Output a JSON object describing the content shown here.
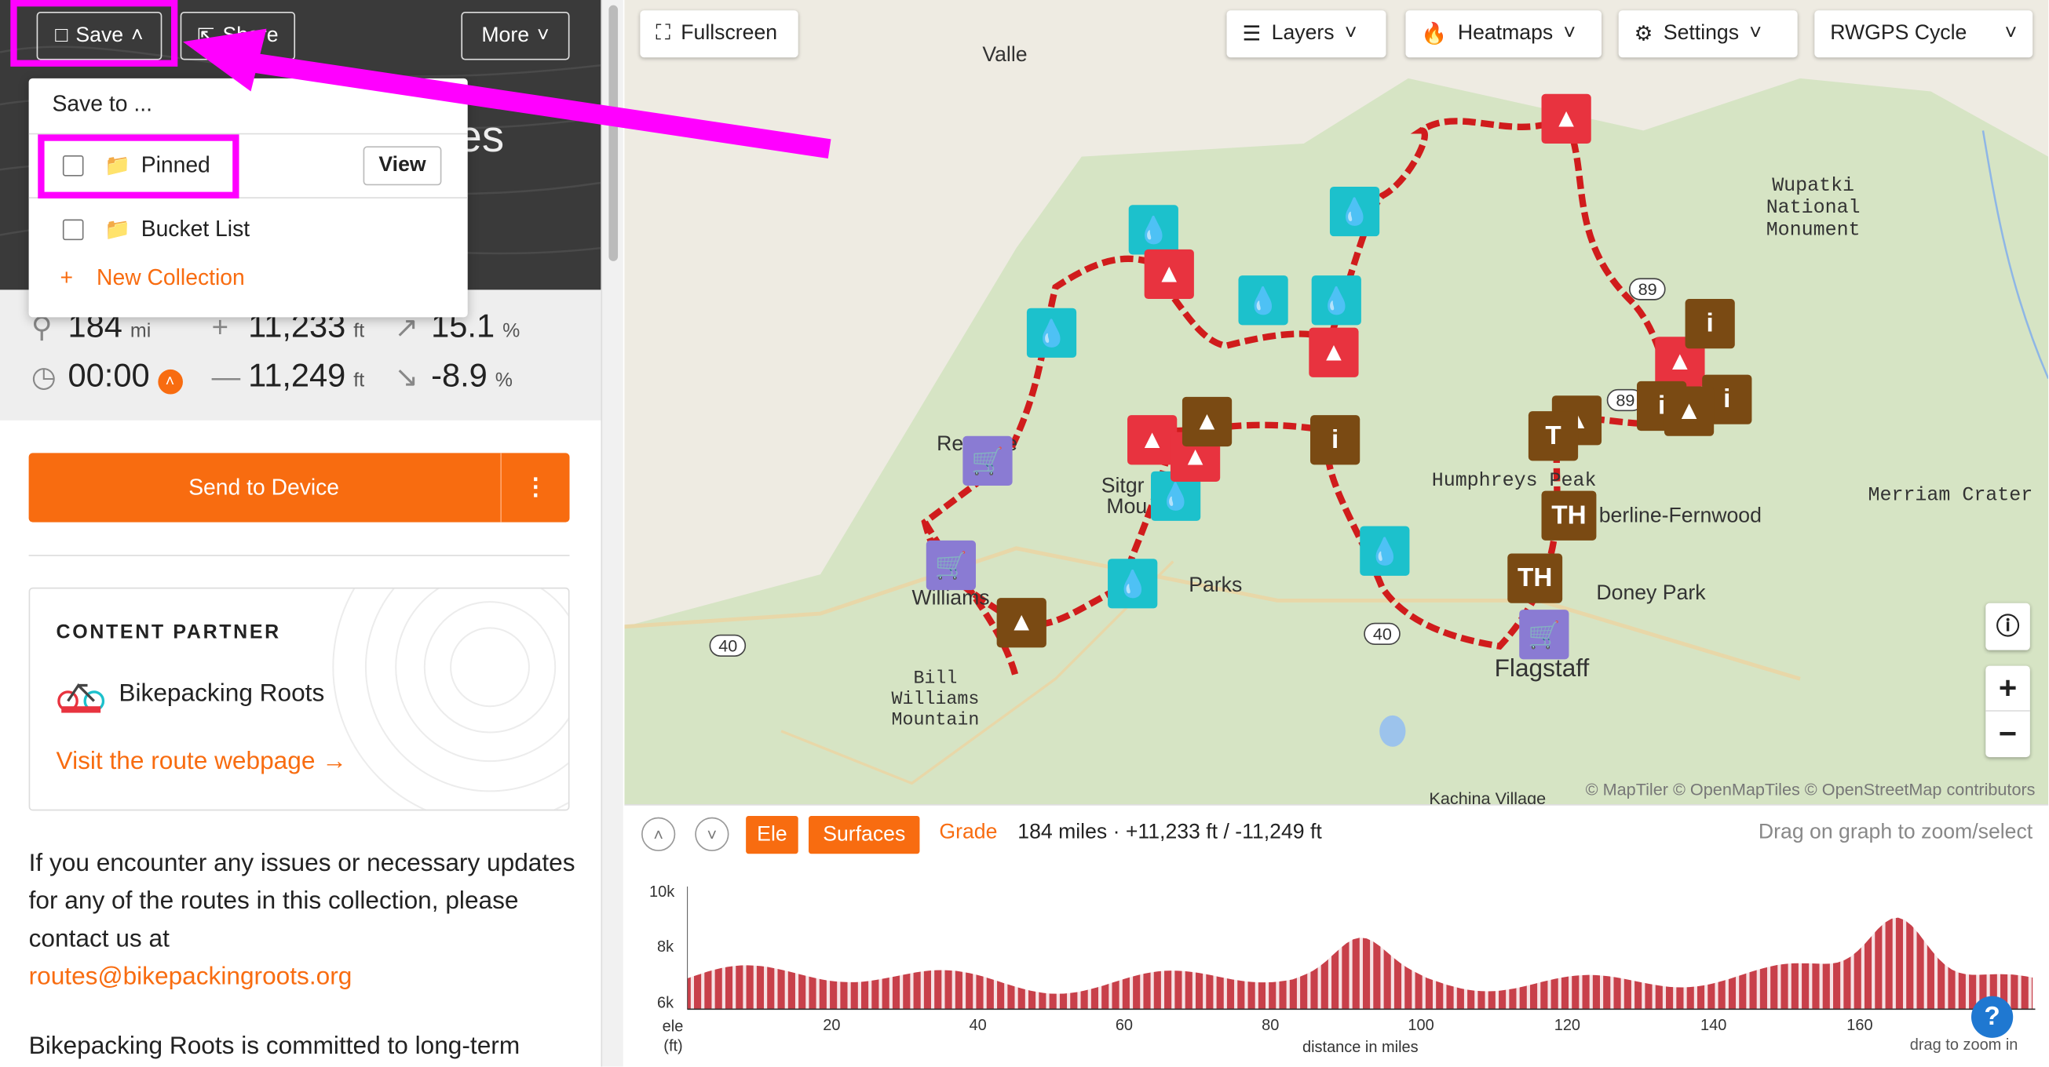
{
  "toolbar": {
    "save": "Save",
    "share": "Share",
    "more": "More"
  },
  "hero": {
    "title_fragment": "es"
  },
  "stats": {
    "distance": "184",
    "distance_unit": "mi",
    "gain": "11,233",
    "gain_unit": "ft",
    "grade_up": "15.1",
    "grade_unit": "%",
    "time": "00:00",
    "loss": "11,249",
    "loss_unit": "ft",
    "grade_down": "-8.9"
  },
  "save_menu": {
    "header": "Save to ...",
    "items": [
      {
        "label": "Pinned",
        "checked": false,
        "action": "View"
      },
      {
        "label": "Bucket List",
        "checked": false
      }
    ],
    "new_collection": "New Collection"
  },
  "send": {
    "label": "Send to Device"
  },
  "partner": {
    "heading": "CONTENT PARTNER",
    "name": "Bikepacking Roots",
    "link": "Visit the route webpage →"
  },
  "body": {
    "para1": "If you encounter any issues or necessary updates for any of the routes in this collection, please contact us at",
    "email": "routes@bikepackingroots.org",
    "para2": "Bikepacking Roots is committed to long-term"
  },
  "map": {
    "fullscreen": "Fullscreen",
    "layers": "Layers",
    "heatmaps": "Heatmaps",
    "settings": "Settings",
    "style": "RWGPS Cycle",
    "attribution": "© MapTiler © OpenMapTiles © OpenStreetMap contributors",
    "labels": {
      "valle": "Valle",
      "wupatki": "Wupatki National Monument",
      "humphreys": "Humphreys Peak",
      "fernwood": "berline-Fernwood",
      "merriam": "Merriam Crater",
      "doney": "Doney Park",
      "flagstaff": "Flagstaff",
      "parks": "Parks",
      "williams": "Williams",
      "bill": "Bill Williams Mountain",
      "red": "Re",
      "redb": "e",
      "sitgr": "Sitgr",
      "mou": "Mou",
      "kachina": "Kachina Village",
      "hw40a": "40",
      "hw40b": "40",
      "hw89a": "89",
      "hw89b": "89"
    }
  },
  "elevation": {
    "ele": "Ele",
    "surfaces": "Surfaces",
    "grade": "Grade",
    "summary": "184 miles · +11,233 ft / -11,249 ft",
    "hint": "Drag on graph to zoom/select",
    "y_labels": [
      "10k",
      "8k",
      "6k"
    ],
    "x_ticks": [
      "20",
      "40",
      "60",
      "80",
      "100",
      "120",
      "140",
      "160"
    ],
    "ylab1": "ele",
    "ylab2": "(ft)",
    "xlabel": "distance in miles",
    "corner_hint": "drag to zoom in"
  },
  "colors": {
    "accent": "#f86c10",
    "annotation": "#ff00ff",
    "route": "#e02020"
  }
}
